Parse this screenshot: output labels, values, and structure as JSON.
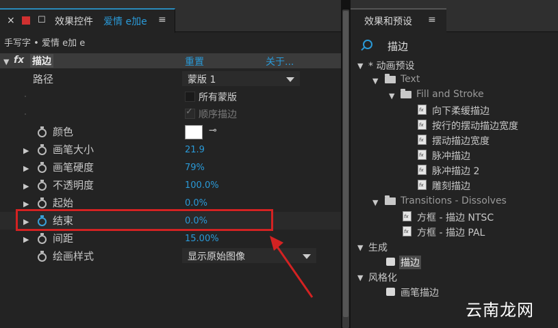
{
  "effect_controls": {
    "tab_title": "效果控件",
    "tab_layer": "爱情 e加e",
    "close_glyph": "×",
    "lock_glyph": "🔓",
    "menu_glyph": "≡",
    "breadcrumb": "手写字 • 爱情 e加 e",
    "effect": {
      "fx_label": "fx",
      "name": "描边",
      "reset": "重置",
      "about": "关于..."
    },
    "properties": [
      {
        "label": "路径"
      },
      {
        "label": "颜色"
      },
      {
        "label": "画笔大小",
        "value": "21.9"
      },
      {
        "label": "画笔硬度",
        "value": "79%"
      },
      {
        "label": "不透明度",
        "value": "100.0%"
      },
      {
        "label": "起始",
        "value": "0.0%"
      },
      {
        "label": "结束",
        "value": "0.0%"
      },
      {
        "label": "间距",
        "value": "15.00%"
      },
      {
        "label": "绘画样式"
      }
    ],
    "path_dropdown": "蒙版 1",
    "all_masks": "所有蒙版",
    "sequential_stroke": "顺序描边",
    "check_glyph": "✓",
    "paint_style_dropdown": "显示原始图像",
    "eyedropper_glyph": "⊸",
    "color_value": "#ffffff"
  },
  "effects_presets": {
    "tab_title": "效果和预设",
    "menu_glyph": "≡",
    "search_value": "描边",
    "tree": [
      {
        "label": "* 动画预设"
      },
      {
        "label": "Text"
      },
      {
        "label": "Fill and Stroke"
      },
      {
        "label": "向下柔缓描边"
      },
      {
        "label": "按行的摆动描边宽度"
      },
      {
        "label": "摆动描边宽度"
      },
      {
        "label": "脉冲描边"
      },
      {
        "label": "脉冲描边 2"
      },
      {
        "label": "雕刻描边"
      },
      {
        "label": "Transitions - Dissolves"
      },
      {
        "label": "方框 - 描边 NTSC"
      },
      {
        "label": "方框 - 描边 PAL"
      },
      {
        "label": "生成"
      },
      {
        "label": "描边"
      },
      {
        "label": "风格化"
      },
      {
        "label": "画笔描边"
      }
    ]
  },
  "watermark": "云南龙网",
  "colors": {
    "accent": "#2a9ad8",
    "highlight": "#d32222",
    "panel_bg": "#232323"
  }
}
